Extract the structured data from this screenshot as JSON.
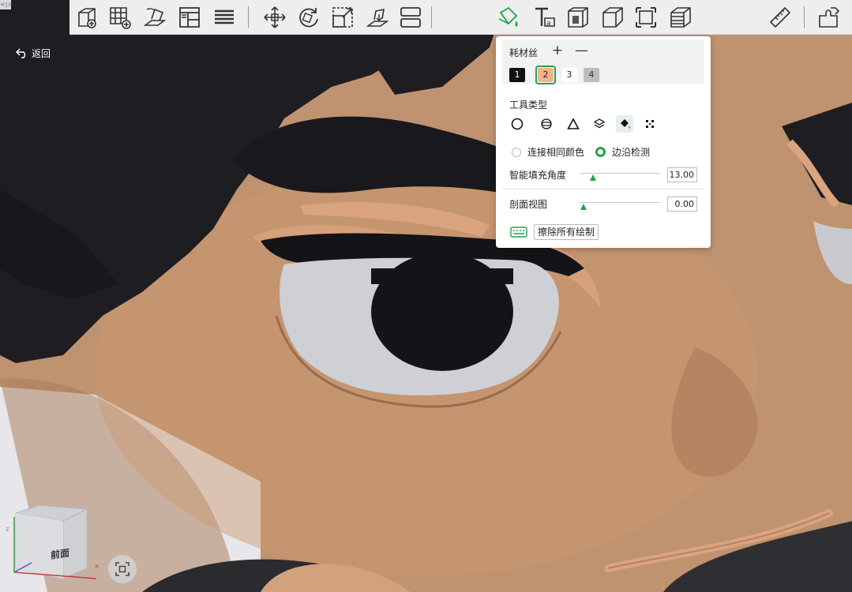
{
  "corner_handle": "<|>",
  "back": {
    "label": "返回"
  },
  "toolbar": {
    "tools": [
      {
        "icon": "add-object-icon"
      },
      {
        "icon": "add-grid-icon"
      },
      {
        "icon": "import-model-icon"
      },
      {
        "icon": "layout-panels-icon"
      },
      {
        "icon": "list-lines-icon"
      },
      {
        "icon": "move-arrows-icon"
      },
      {
        "icon": "rotate-object-icon"
      },
      {
        "icon": "scale-object-icon"
      },
      {
        "icon": "place-on-face-icon"
      },
      {
        "icon": "split-object-icon"
      },
      {
        "icon": "paint-bucket-icon"
      },
      {
        "icon": "text-tool-icon"
      },
      {
        "icon": "emboss-icon"
      },
      {
        "icon": "cube-cut-icon"
      },
      {
        "icon": "seam-painting-icon"
      },
      {
        "icon": "variable-layer-icon"
      },
      {
        "icon": "measure-ruler-icon"
      },
      {
        "icon": "assembly-puzzle-icon"
      }
    ],
    "active_tool": "paint-bucket-icon",
    "accent": "#1fa34a"
  },
  "panel": {
    "filament_title": "耗材丝",
    "plus": "+",
    "minus": "—",
    "filaments": [
      {
        "label": "1",
        "color": "#111111",
        "text_color": "#ffffff"
      },
      {
        "label": "2",
        "color": "#f2b38c",
        "text_color": "#222222"
      },
      {
        "label": "3",
        "color": "#ffffff",
        "text_color": "#222222"
      },
      {
        "label": "4",
        "color": "#bdbdbd",
        "text_color": "#333333"
      }
    ],
    "selected_filament": "2",
    "tool_type_label": "工具类型",
    "tool_types": [
      {
        "icon": "circle-brush-icon"
      },
      {
        "icon": "sphere-brush-icon"
      },
      {
        "icon": "triangle-brush-icon"
      },
      {
        "icon": "height-range-icon"
      },
      {
        "icon": "fill-bucket-icon"
      },
      {
        "icon": "gap-fill-icon"
      }
    ],
    "selected_tool_type": "fill-bucket-icon",
    "fill_options": [
      {
        "label": "连接相同颜色",
        "checked": false
      },
      {
        "label": "边沿检测",
        "checked": true
      }
    ],
    "smart_fill_angle": {
      "label": "智能填充角度",
      "value": "13.00",
      "fraction": 0.17
    },
    "section_view": {
      "label": "剖面视图",
      "value": "0.00",
      "fraction": 0.05
    },
    "clear_all": "擦除所有绘制"
  },
  "viewcube": {
    "front": "前面",
    "z": "z",
    "x": "x"
  }
}
